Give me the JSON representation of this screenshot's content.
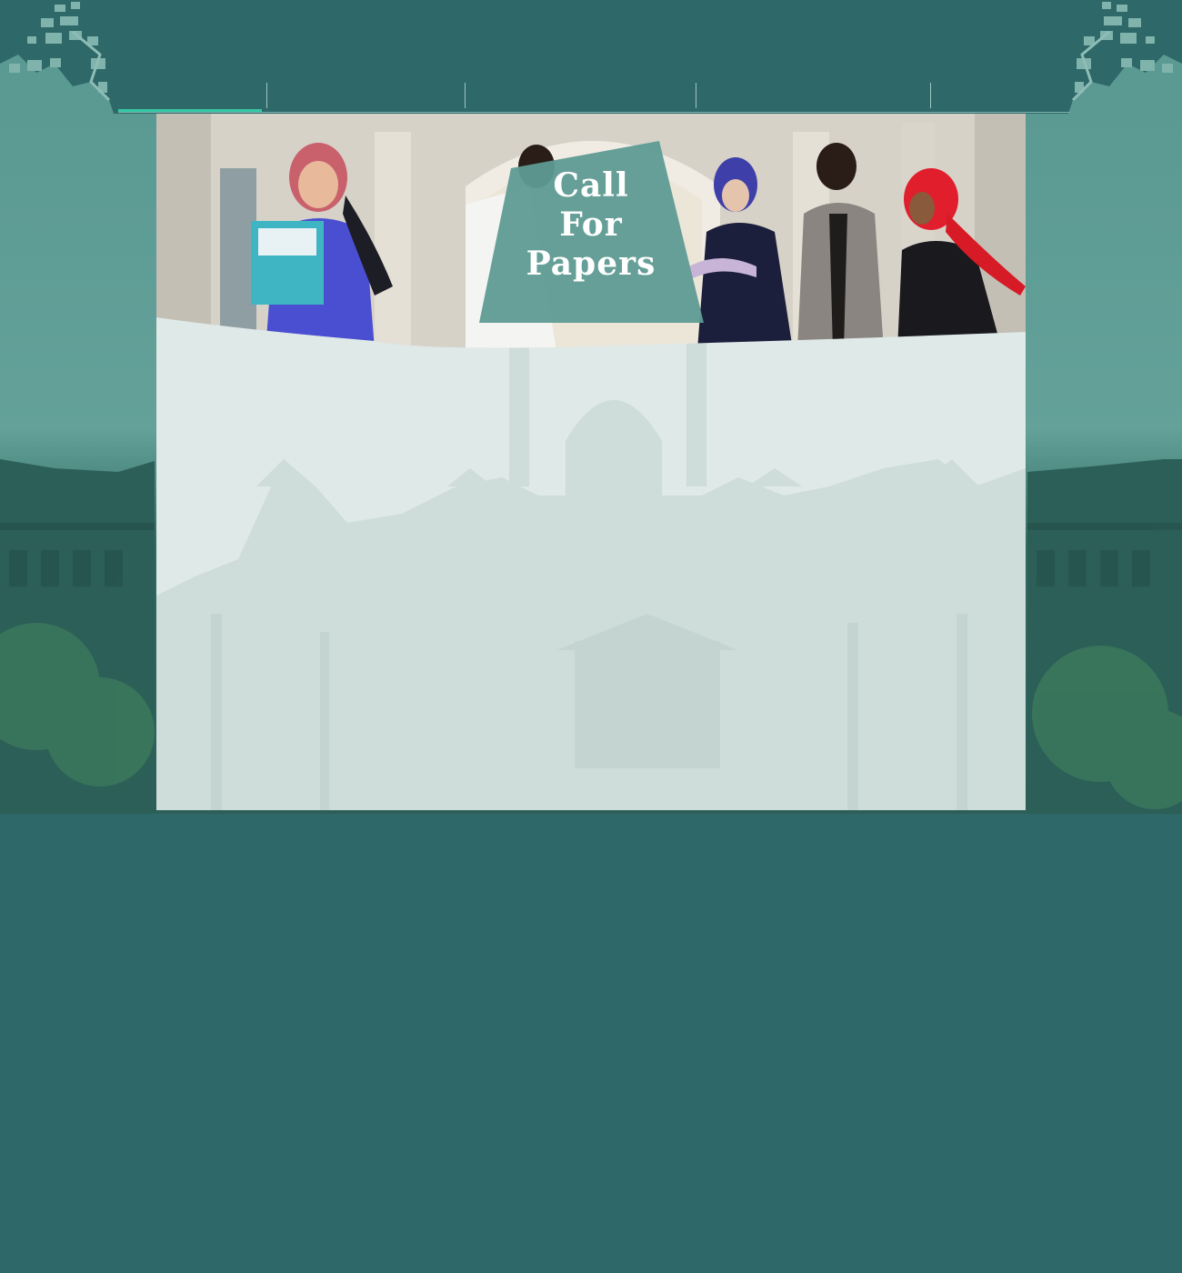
{
  "nav": {
    "items": [
      {
        "label": "",
        "active": true
      },
      {
        "label": "",
        "active": false
      },
      {
        "label": "",
        "active": false
      },
      {
        "label": "",
        "active": false
      },
      {
        "label": "",
        "active": false
      }
    ]
  },
  "banner": {
    "title_line1": "Call",
    "title_line2": "For",
    "title_line3": "Papers"
  },
  "colors": {
    "background": "#2e6869",
    "accent": "#35c7a4",
    "panel": "#dee9e8",
    "banner_shape": "#5e9b94"
  }
}
